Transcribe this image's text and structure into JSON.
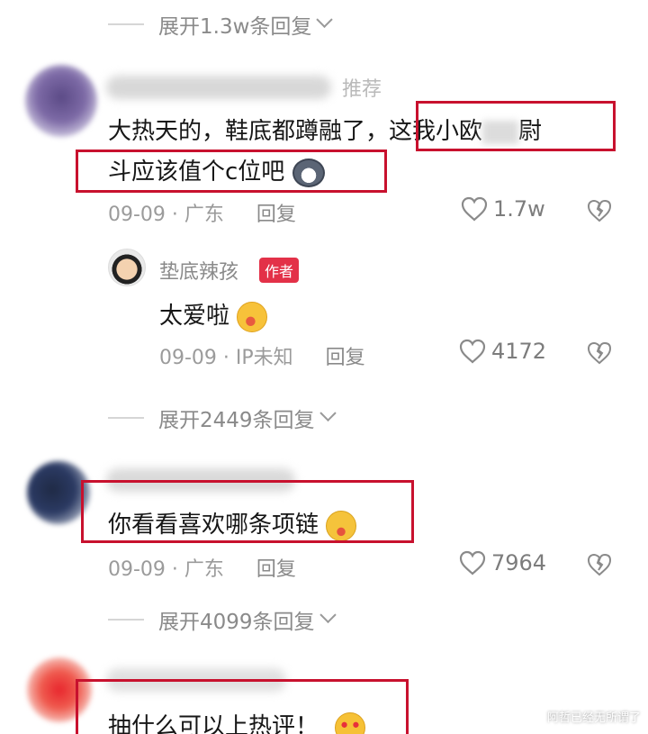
{
  "expanders": [
    "展开1.3w条回复",
    "展开2449条回复",
    "展开4099条回复"
  ],
  "comments": [
    {
      "tag": "推荐",
      "text_part1": "大热天的，鞋底都蹲融了，",
      "text_part2": "这我小欧",
      "text_part3": "斗应该值个c位吧",
      "date": "09-09 · 广东",
      "reply": "回复",
      "likes": "1.7w"
    },
    {
      "text": "你看看喜欢哪条项链",
      "date": "09-09 · 广东",
      "reply": "回复",
      "likes": "7964"
    },
    {
      "text": "抽什么可以上热评！"
    }
  ],
  "author_reply": {
    "name": "垫底辣孩",
    "badge": "作者",
    "text": "太爱啦",
    "date": "09-09 · IP未知",
    "reply": "回复",
    "likes": "4172"
  },
  "watermark": "阿哲已经无所谓了",
  "colors": {
    "highlight": "#c8112e",
    "badge": "#e33148",
    "meta": "#9b9b9b"
  }
}
